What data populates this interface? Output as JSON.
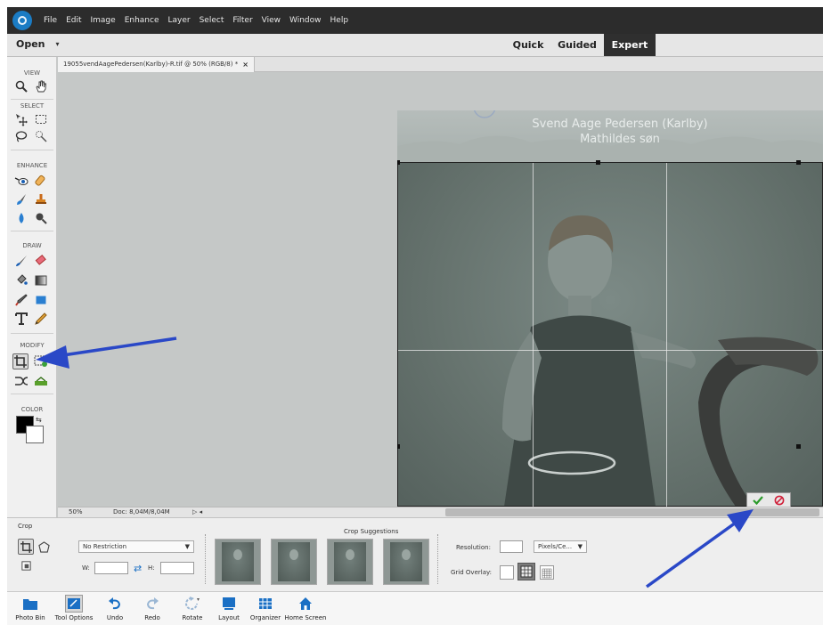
{
  "menu": [
    "File",
    "Edit",
    "Image",
    "Enhance",
    "Layer",
    "Select",
    "Filter",
    "View",
    "Window",
    "Help"
  ],
  "mode_bar": {
    "open_label": "Open",
    "tabs": [
      "Quick",
      "Guided",
      "Expert"
    ],
    "active_tab": "Expert"
  },
  "toolbox": {
    "sections": [
      "VIEW",
      "SELECT",
      "ENHANCE",
      "DRAW",
      "MODIFY",
      "COLOR"
    ],
    "selected_tool": "crop-tool"
  },
  "document": {
    "tab_title": "19055vendAageP​edersen(Karlby)-R.tif @ 50% (RGB/8) *",
    "close": "×"
  },
  "photo": {
    "caption_line1": "Svend Aage Pedersen (Karlby)",
    "caption_line2": "Mathildes søn"
  },
  "status": {
    "zoom": "50%",
    "doc": "Doc: 8,04M/8,04M",
    "nav": "▷ ◂"
  },
  "tool_options": {
    "tool_name": "Crop",
    "aspect_select": "No Restriction",
    "width_label": "W:",
    "height_label": "H:",
    "suggestions_label": "Crop Suggestions",
    "resolution_label": "Resolution:",
    "resolution_unit": "Pixels/Ce...",
    "grid_overlay_label": "Grid Overlay:"
  },
  "taskbar": [
    "Photo Bin",
    "Tool Options",
    "Undo",
    "Redo",
    "Rotate",
    "Layout",
    "Organizer",
    "Home Screen"
  ],
  "colors": {
    "menubar": "#2c2c2c",
    "accent_blue": "#2a48c7",
    "commit_green": "#2a9a2a",
    "cancel_red": "#d0213a"
  }
}
